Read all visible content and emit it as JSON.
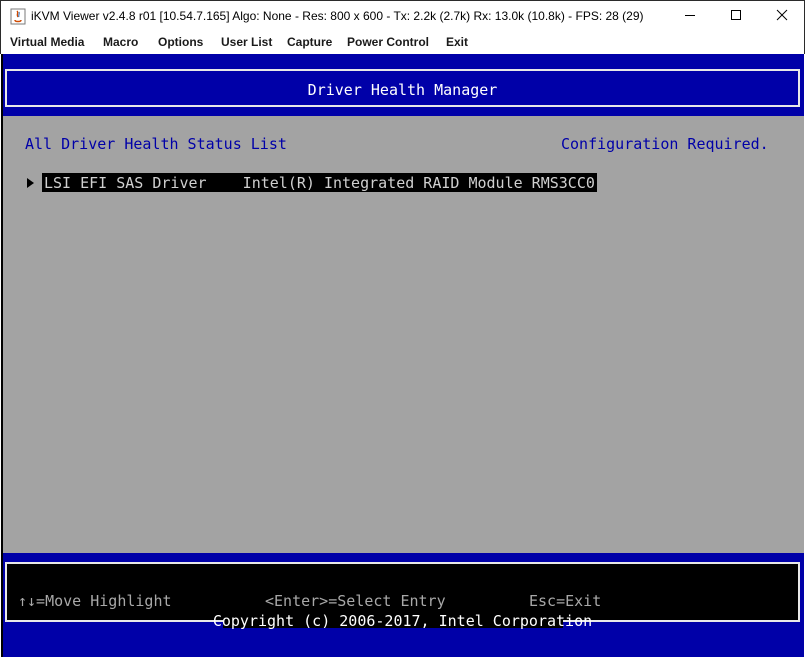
{
  "window": {
    "title": "iKVM Viewer v2.4.8 r01 [10.54.7.165] Algo: None - Res: 800 x 600 - Tx: 2.2k (2.7k) Rx: 13.0k (10.8k) - FPS: 28 (29)",
    "minimize_icon": "minimize-icon",
    "maximize_icon": "maximize-icon",
    "close_icon": "close-icon"
  },
  "menu": [
    {
      "label": "Virtual Media"
    },
    {
      "label": "Macro"
    },
    {
      "label": "Options"
    },
    {
      "label": "User List"
    },
    {
      "label": "Capture"
    },
    {
      "label": "Power Control"
    },
    {
      "label": "Exit"
    }
  ],
  "bios": {
    "header_title": "Driver Health Manager",
    "section_label": "All Driver Health Status List",
    "status_label": "Configuration Required.",
    "entry": {
      "text": "LSI EFI SAS Driver    Intel(R) Integrated RAID Module RMS3CC0"
    },
    "help": {
      "move": "↑↓=Move Highlight",
      "select": "<Enter>=Select Entry",
      "exit": "Esc=Exit"
    },
    "copyright": "Copyright (c) 2006-2017, Intel Corporation"
  },
  "colors": {
    "bios_blue": "#0000a8",
    "bios_gray": "#a3a3a3",
    "bios_black": "#000000"
  }
}
